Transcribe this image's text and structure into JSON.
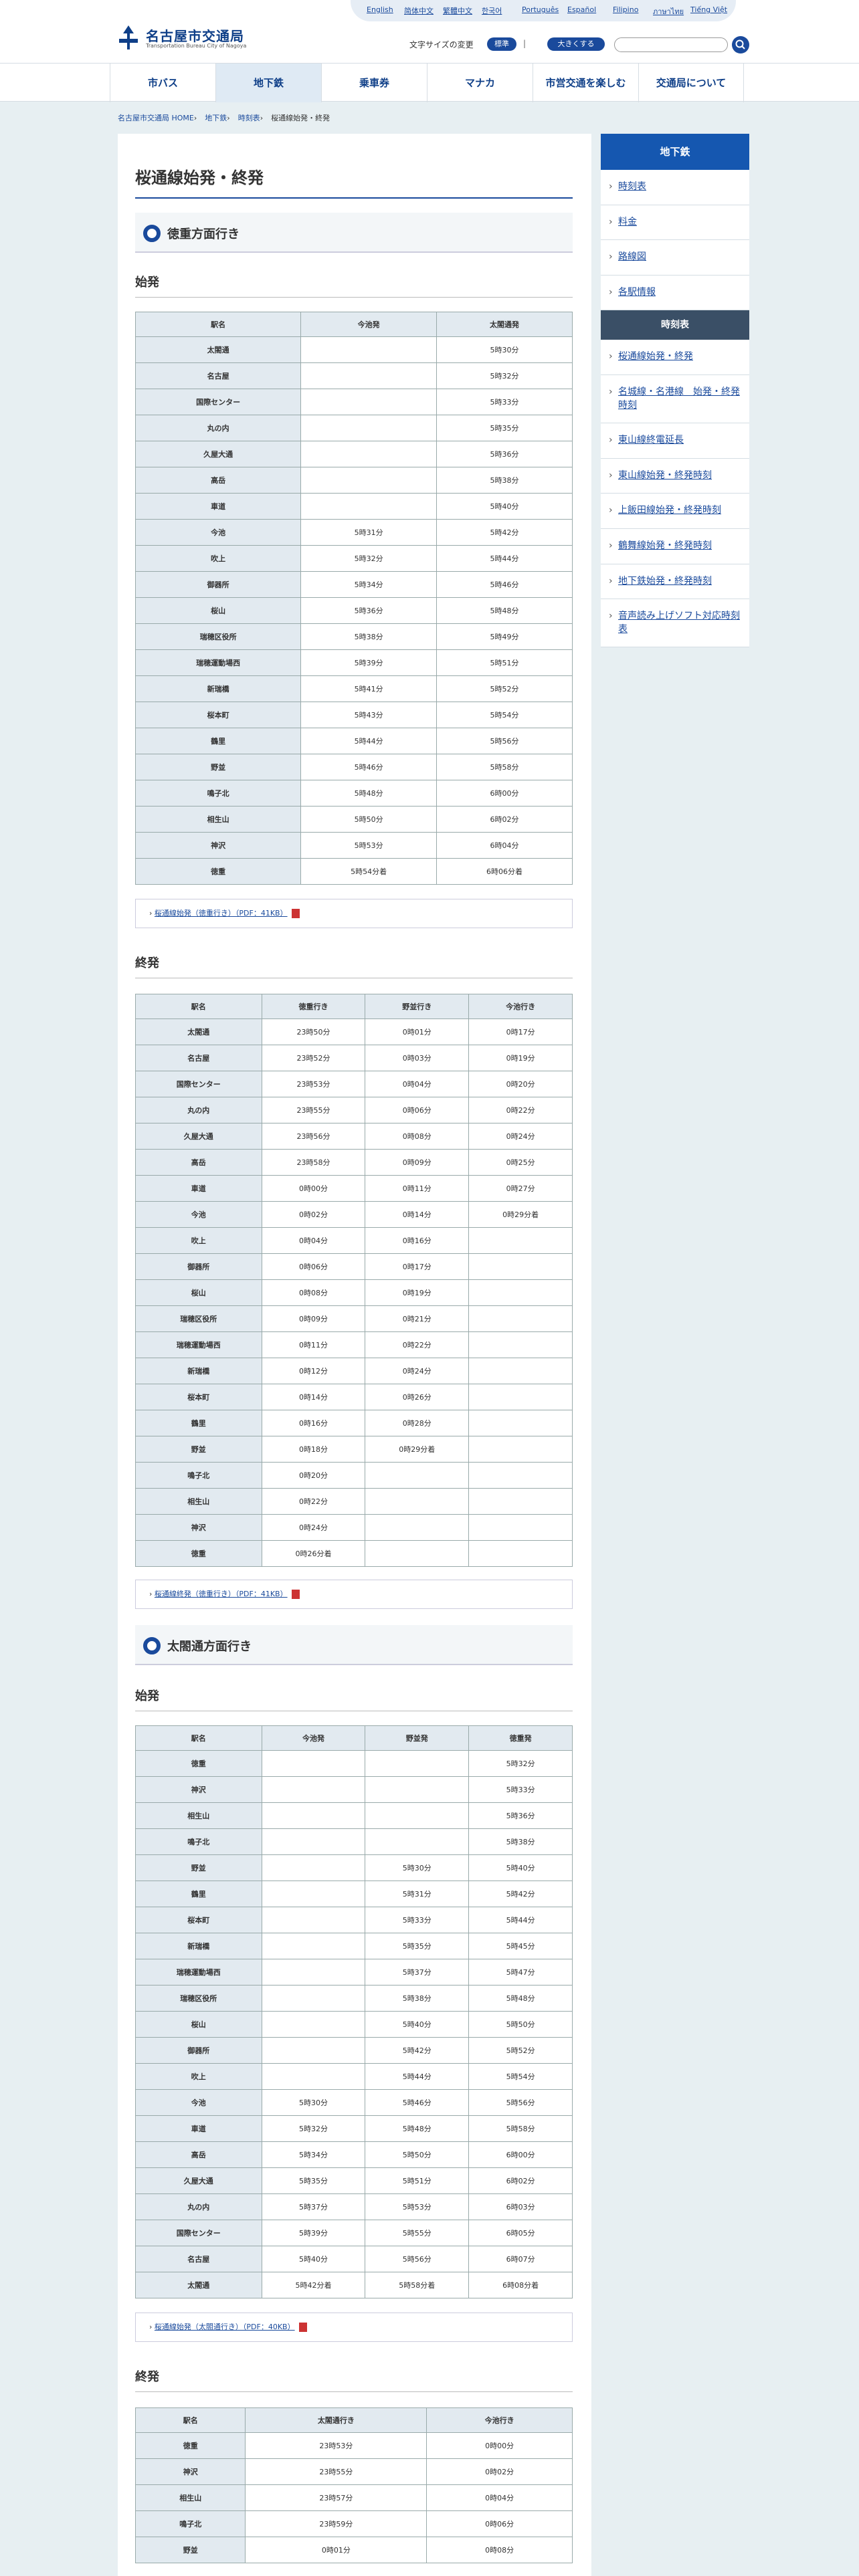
{
  "header": {
    "logo_name": "名古屋市交通局",
    "logo_sub": "Transportation Bureau City of Nagoya",
    "languages": [
      "English",
      "简体中文",
      "繁體中文",
      "한국어",
      "Português",
      "Español",
      "Filipino",
      "ภาษาไทย",
      "Tiếng Việt"
    ],
    "font_size_label": "文字サイズの変更",
    "font_std": "標準",
    "font_big": "大きくする",
    "search_placeholder": ""
  },
  "nav": [
    "市バス",
    "地下鉄",
    "乗車券",
    "マナカ",
    "市営交通を楽しむ",
    "交通局について"
  ],
  "breadcrumb": [
    "名古屋市交通局 HOME",
    "地下鉄",
    "時刻表",
    "桜通線始発・終発"
  ],
  "page_title": "桜通線始発・終発",
  "sec1": {
    "title": "徳重方面行き",
    "first": {
      "title": "始発",
      "head": [
        "駅名",
        "今池発",
        "太閤通発"
      ],
      "rows": [
        [
          "太閤通",
          "",
          "5時30分"
        ],
        [
          "名古屋",
          "",
          "5時32分"
        ],
        [
          "国際センター",
          "",
          "5時33分"
        ],
        [
          "丸の内",
          "",
          "5時35分"
        ],
        [
          "久屋大通",
          "",
          "5時36分"
        ],
        [
          "高岳",
          "",
          "5時38分"
        ],
        [
          "車道",
          "",
          "5時40分"
        ],
        [
          "今池",
          "5時31分",
          "5時42分"
        ],
        [
          "吹上",
          "5時32分",
          "5時44分"
        ],
        [
          "御器所",
          "5時34分",
          "5時46分"
        ],
        [
          "桜山",
          "5時36分",
          "5時48分"
        ],
        [
          "瑞穂区役所",
          "5時38分",
          "5時49分"
        ],
        [
          "瑞穂運動場西",
          "5時39分",
          "5時51分"
        ],
        [
          "新瑞橋",
          "5時41分",
          "5時52分"
        ],
        [
          "桜本町",
          "5時43分",
          "5時54分"
        ],
        [
          "鶴里",
          "5時44分",
          "5時56分"
        ],
        [
          "野並",
          "5時46分",
          "5時58分"
        ],
        [
          "鳴子北",
          "5時48分",
          "6時00分"
        ],
        [
          "相生山",
          "5時50分",
          "6時02分"
        ],
        [
          "神沢",
          "5時53分",
          "6時04分"
        ],
        [
          "徳重",
          "5時54分着",
          "6時06分着"
        ]
      ]
    },
    "first_pdf": "桜通線始発（徳重行き）（PDF：41KB）",
    "last": {
      "title": "終発",
      "head": [
        "駅名",
        "徳重行き",
        "野並行き",
        "今池行き"
      ],
      "rows": [
        [
          "太閤通",
          "23時50分",
          "0時01分",
          "0時17分"
        ],
        [
          "名古屋",
          "23時52分",
          "0時03分",
          "0時19分"
        ],
        [
          "国際センター",
          "23時53分",
          "0時04分",
          "0時20分"
        ],
        [
          "丸の内",
          "23時55分",
          "0時06分",
          "0時22分"
        ],
        [
          "久屋大通",
          "23時56分",
          "0時08分",
          "0時24分"
        ],
        [
          "高岳",
          "23時58分",
          "0時09分",
          "0時25分"
        ],
        [
          "車道",
          "0時00分",
          "0時11分",
          "0時27分"
        ],
        [
          "今池",
          "0時02分",
          "0時14分",
          "0時29分着"
        ],
        [
          "吹上",
          "0時04分",
          "0時16分",
          ""
        ],
        [
          "御器所",
          "0時06分",
          "0時17分",
          ""
        ],
        [
          "桜山",
          "0時08分",
          "0時19分",
          ""
        ],
        [
          "瑞穂区役所",
          "0時09分",
          "0時21分",
          ""
        ],
        [
          "瑞穂運動場西",
          "0時11分",
          "0時22分",
          ""
        ],
        [
          "新瑞橋",
          "0時12分",
          "0時24分",
          ""
        ],
        [
          "桜本町",
          "0時14分",
          "0時26分",
          ""
        ],
        [
          "鶴里",
          "0時16分",
          "0時28分",
          ""
        ],
        [
          "野並",
          "0時18分",
          "0時29分着",
          ""
        ],
        [
          "鳴子北",
          "0時20分",
          "",
          ""
        ],
        [
          "相生山",
          "0時22分",
          "",
          ""
        ],
        [
          "神沢",
          "0時24分",
          "",
          ""
        ],
        [
          "徳重",
          "0時26分着",
          "",
          ""
        ]
      ]
    },
    "last_pdf": "桜通線終発（徳重行き）（PDF：41KB）"
  },
  "sec2": {
    "title": "太閤通方面行き",
    "first": {
      "title": "始発",
      "head": [
        "駅名",
        "今池発",
        "野並発",
        "徳重発"
      ],
      "rows": [
        [
          "徳重",
          "",
          "",
          "5時32分"
        ],
        [
          "神沢",
          "",
          "",
          "5時33分"
        ],
        [
          "相生山",
          "",
          "",
          "5時36分"
        ],
        [
          "鳴子北",
          "",
          "",
          "5時38分"
        ],
        [
          "野並",
          "",
          "5時30分",
          "5時40分"
        ],
        [
          "鶴里",
          "",
          "5時31分",
          "5時42分"
        ],
        [
          "桜本町",
          "",
          "5時33分",
          "5時44分"
        ],
        [
          "新瑞橋",
          "",
          "5時35分",
          "5時45分"
        ],
        [
          "瑞穂運動場西",
          "",
          "5時37分",
          "5時47分"
        ],
        [
          "瑞穂区役所",
          "",
          "5時38分",
          "5時48分"
        ],
        [
          "桜山",
          "",
          "5時40分",
          "5時50分"
        ],
        [
          "御器所",
          "",
          "5時42分",
          "5時52分"
        ],
        [
          "吹上",
          "",
          "5時44分",
          "5時54分"
        ],
        [
          "今池",
          "5時30分",
          "5時46分",
          "5時56分"
        ],
        [
          "車道",
          "5時32分",
          "5時48分",
          "5時58分"
        ],
        [
          "高岳",
          "5時34分",
          "5時50分",
          "6時00分"
        ],
        [
          "久屋大通",
          "5時35分",
          "5時51分",
          "6時02分"
        ],
        [
          "丸の内",
          "5時37分",
          "5時53分",
          "6時03分"
        ],
        [
          "国際センター",
          "5時39分",
          "5時55分",
          "6時05分"
        ],
        [
          "名古屋",
          "5時40分",
          "5時56分",
          "6時07分"
        ],
        [
          "太閤通",
          "5時42分着",
          "5時58分着",
          "6時08分着"
        ]
      ]
    },
    "first_pdf": "桜通線始発（太閤通行き）（PDF：40KB）",
    "last": {
      "title": "終発",
      "head": [
        "駅名",
        "太閤通行き",
        "今池行き"
      ],
      "rows": [
        [
          "徳重",
          "23時53分",
          "0時00分"
        ],
        [
          "神沢",
          "23時55分",
          "0時02分"
        ],
        [
          "相生山",
          "23時57分",
          "0時04分"
        ],
        [
          "鳴子北",
          "23時59分",
          "0時06分"
        ],
        [
          "野並",
          "0時01分",
          "0時08分"
        ]
      ]
    }
  },
  "side": {
    "head": "地下鉄",
    "items": [
      "時刻表",
      "料金",
      "路線図",
      "各駅情報"
    ],
    "head2": "時刻表",
    "items2": [
      "桜通線始発・終発",
      "名城線・名港線　始発・終発時刻",
      "東山線終電延長",
      "東山線始発・終発時刻",
      "上飯田線始発・終発時刻",
      "鶴舞線始発・終発時刻",
      "地下鉄始発・終発時刻",
      "音声読み上げソフト対応時刻表"
    ]
  }
}
